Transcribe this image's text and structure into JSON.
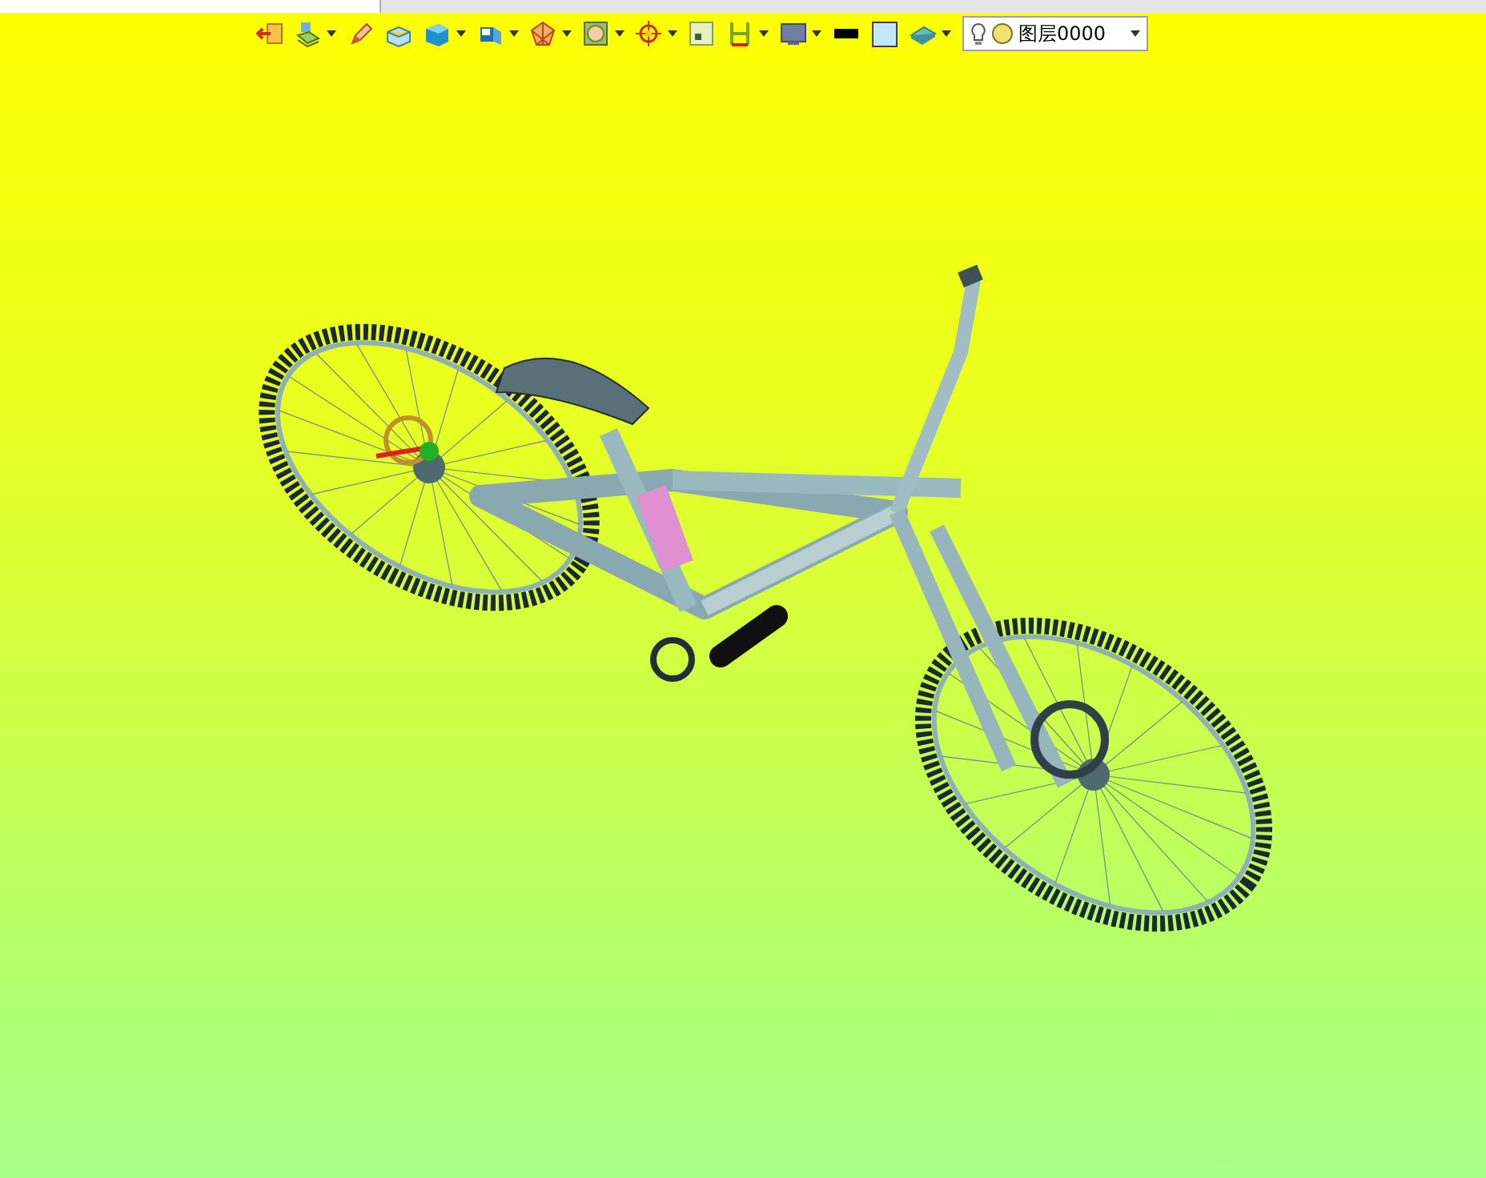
{
  "toolbar": {
    "buttons": [
      {
        "dropdown": false
      },
      {
        "dropdown": true
      },
      {
        "dropdown": false
      },
      {
        "dropdown": false
      },
      {
        "dropdown": true
      },
      {
        "dropdown": true
      },
      {
        "dropdown": true
      },
      {
        "dropdown": true
      },
      {
        "dropdown": true
      },
      {
        "dropdown": false
      },
      {
        "dropdown": true
      },
      {
        "dropdown": true
      },
      {
        "dropdown": false
      },
      {
        "dropdown": false
      },
      {
        "dropdown": true
      }
    ],
    "layer_selector": {
      "value": "图层0000"
    }
  }
}
